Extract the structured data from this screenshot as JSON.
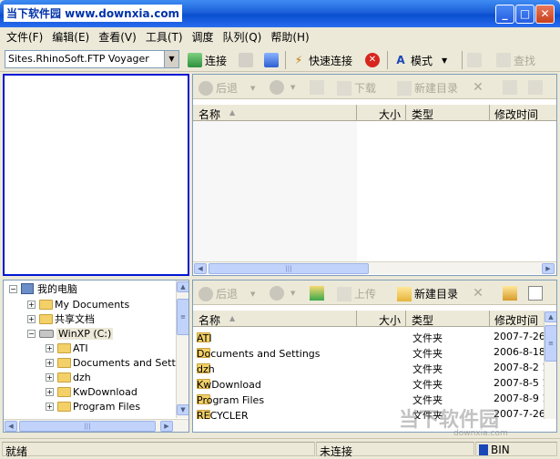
{
  "window": {
    "title": "当下软件园 www.downxia.com",
    "buttons": {
      "minimize": "_",
      "maximize": "□",
      "close": "✕"
    }
  },
  "menu": [
    "文件(F)",
    "编辑(E)",
    "查看(V)",
    "工具(T)",
    "调度",
    "队列(Q)",
    "帮助(H)"
  ],
  "toolbar": {
    "site": "Sites.RhinoSoft.FTP Voyager",
    "connect": "连接",
    "quick_connect": "快速连接",
    "mode": "模式",
    "search": "查找"
  },
  "remote_panel": {
    "back": "后退",
    "download": "下载",
    "new_dir": "新建目录",
    "headers": {
      "name": "名称",
      "size": "大小",
      "type": "类型",
      "modified": "修改时间"
    }
  },
  "local_panel": {
    "back": "后退",
    "upload": "上传",
    "new_dir": "新建目录",
    "headers": {
      "name": "名称",
      "size": "大小",
      "type": "类型",
      "modified": "修改时间"
    },
    "files": [
      {
        "name": "ATI",
        "type": "文件夹",
        "modified": "2007-7-26"
      },
      {
        "name": "Documents and Settings",
        "type": "文件夹",
        "modified": "2006-8-18"
      },
      {
        "name": "dzh",
        "type": "文件夹",
        "modified": "2007-8-2 1"
      },
      {
        "name": "KwDownload",
        "type": "文件夹",
        "modified": "2007-8-5 1"
      },
      {
        "name": "Program Files",
        "type": "文件夹",
        "modified": "2007-8-9 1"
      },
      {
        "name": "RECYCLER",
        "type": "文件夹",
        "modified": "2007-7-26"
      }
    ]
  },
  "tree": {
    "root": "我的电脑",
    "items": [
      "My Documents",
      "共享文档",
      "WinXP (C:)"
    ],
    "children": [
      "ATI",
      "Documents and Settin",
      "dzh",
      "KwDownload",
      "Program Files"
    ]
  },
  "status": {
    "ready": "就绪",
    "connection": "未连接",
    "mode": "BIN"
  },
  "watermark": {
    "text": "当下软件园",
    "sub": "downxia.com"
  }
}
